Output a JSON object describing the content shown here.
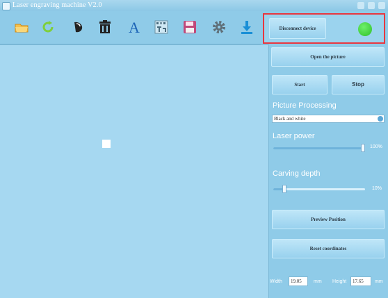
{
  "window": {
    "title": "Laser engraving machine V2.0"
  },
  "toolbar": {
    "tools": [
      {
        "name": "open-image-icon",
        "color": "#f2b13a"
      },
      {
        "name": "rotate-icon",
        "color": "#7fcf3b"
      },
      {
        "name": "flip-icon",
        "color": "#222222"
      },
      {
        "name": "delete-icon",
        "color": "#222222"
      },
      {
        "name": "text-icon",
        "color": "#1f66b8"
      },
      {
        "name": "grayscale-icon",
        "color": "#4a6b7d"
      },
      {
        "name": "save-icon",
        "color": "#c0497a"
      },
      {
        "name": "settings-icon",
        "color": "#5f6f78"
      },
      {
        "name": "download-icon",
        "color": "#1a8fd6"
      }
    ]
  },
  "connection": {
    "button_label": "Disconnect device",
    "status_color": "#2fc02a"
  },
  "controls": {
    "open_picture_label": "Open the picture",
    "start_label": "Start",
    "stop_label": "Stop",
    "picture_processing_label": "Picture Processing",
    "picture_processing_value": "Black and white",
    "laser_power_label": "Laser power",
    "laser_power_value": "100%",
    "laser_power_level": 1.0,
    "carving_depth_label": "Carving depth",
    "carving_depth_value": "10%",
    "carving_depth_level": 0.1,
    "preview_position_label": "Preview Position",
    "reset_coordinates_label": "Reset coordinates"
  },
  "dimensions": {
    "width_label": "Width",
    "width_value": "19.05",
    "width_unit": "mm",
    "height_label": "Height",
    "height_value": "17.65",
    "height_unit": "mm"
  }
}
